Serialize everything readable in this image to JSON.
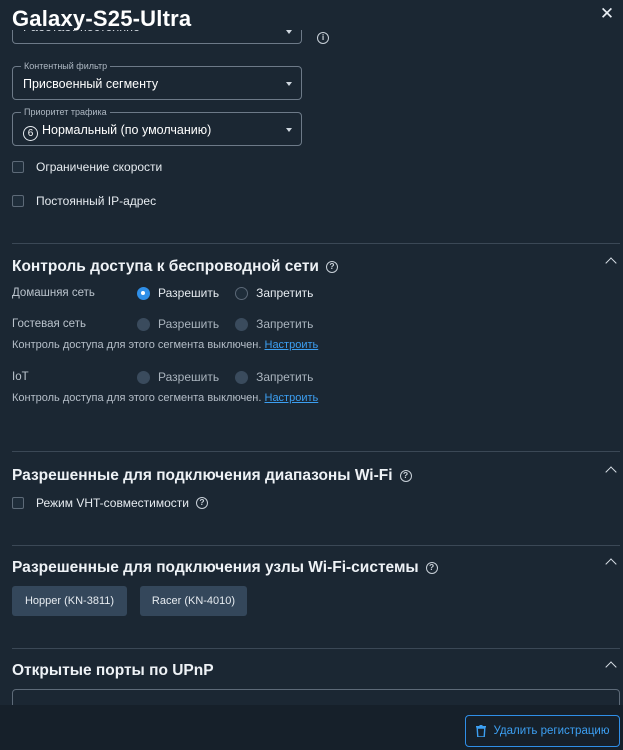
{
  "header": {
    "title": "Galaxy-S25-Ultra"
  },
  "fields": {
    "mode_value_partial": "Работает постоянно",
    "content_filter": {
      "legend": "Контентный фильтр",
      "value": "Присвоенный сегменту"
    },
    "traffic_priority": {
      "legend": "Приоритет трафика",
      "badge": "6",
      "value": "Нормальный (по умолчанию)"
    }
  },
  "checkboxes": {
    "speed_limit": "Ограничение скорости",
    "static_ip": "Постоянный IP-адрес"
  },
  "wireless_access": {
    "title": "Контроль доступа к беспроводной сети",
    "allow_label": "Разрешить",
    "deny_label": "Запретить",
    "note_text": "Контроль доступа для этого сегмента выключен.",
    "note_link": "Настроить",
    "rows": [
      {
        "name": "Домашняя сеть",
        "selected": "allow"
      },
      {
        "name": "Гостевая сеть",
        "selected": "none"
      },
      {
        "name": "IoT",
        "selected": "none"
      }
    ]
  },
  "wifi_bands": {
    "title": "Разрешенные для подключения диапазоны Wi-Fi",
    "vht_label": "Режим VHT-совместимости"
  },
  "mesh_nodes": {
    "title": "Разрешенные для подключения узлы Wi-Fi-системы",
    "nodes": [
      "Hopper (KN-3811)",
      "Racer (KN-4010)"
    ]
  },
  "upnp": {
    "title": "Открытые порты по UPnP"
  },
  "footer": {
    "delete_label": "Удалить регистрацию"
  },
  "colors": {
    "background": "#1b2733",
    "accent": "#2f8fe8",
    "link": "#3c9ff2"
  }
}
